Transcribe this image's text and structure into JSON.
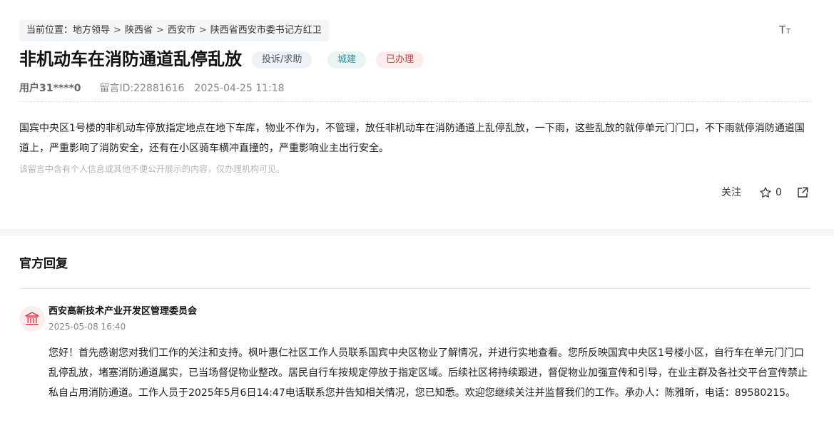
{
  "breadcrumb": {
    "prefix": "当前位置：",
    "items": [
      "地方领导",
      "陕西省",
      "西安市",
      "陕西省西安市委书记方红卫"
    ],
    "separator": ">"
  },
  "font_size_icon": "Tт",
  "post": {
    "title": "非机动车在消防通道乱停乱放",
    "tags": [
      "投诉/求助",
      "城建",
      "已办理"
    ],
    "user": "用户31****0",
    "message_id": "留言ID:22881616",
    "datetime": "2025-04-25 11:18",
    "content": "国宾中央区1号楼的非机动车停放指定地点在地下车库，物业不作为，不管理，放任非机动车在消防通道上乱停乱放，一下雨，这些乱放的就停单元门门口，不下雨就停消防通道国道上，严重影响了消防安全，还有在小区骑车横冲直撞的，严重影响业主出行安全。",
    "privacy_notice": "该留言中含有个人信息或其他不便公开展示的内容，仅办理机构可见。"
  },
  "actions": {
    "follow_label": "关注",
    "star_count": "0"
  },
  "reply": {
    "section_title": "官方回复",
    "org_name": "西安高新技术产业开发区管理委员会",
    "datetime": "2025-05-08 16:40",
    "content": "您好！首先感谢您对我们工作的关注和支持。枫叶惠仁社区工作人员联系国宾中央区物业了解情况，并进行实地查看。您所反映国宾中央区1号楼小区，自行车在单元门门口乱停乱放，堵塞消防通道属实，已当场督促物业整改。居民自行车按规定停放于指定区域。后续社区将持续跟进，督促物业加强宣传和引导，在业主群及各社交平台宣传禁止私自占用消防通道。工作人员于2025年5月6日14:47电话联系您并告知相关情况，您已知悉。欢迎您继续关注并监督我们的工作。承办人：陈雅昕，电话：89580215。"
  },
  "icons": {
    "font_size": "font-size-icon",
    "star": "star-icon",
    "share": "share-icon",
    "org": "government-building-icon"
  },
  "colors": {
    "tag_complaint_bg": "#eef1f6",
    "tag_urban_text": "#2f8f9e",
    "tag_done_text": "#d9363e",
    "org_icon": "#d9363e"
  }
}
